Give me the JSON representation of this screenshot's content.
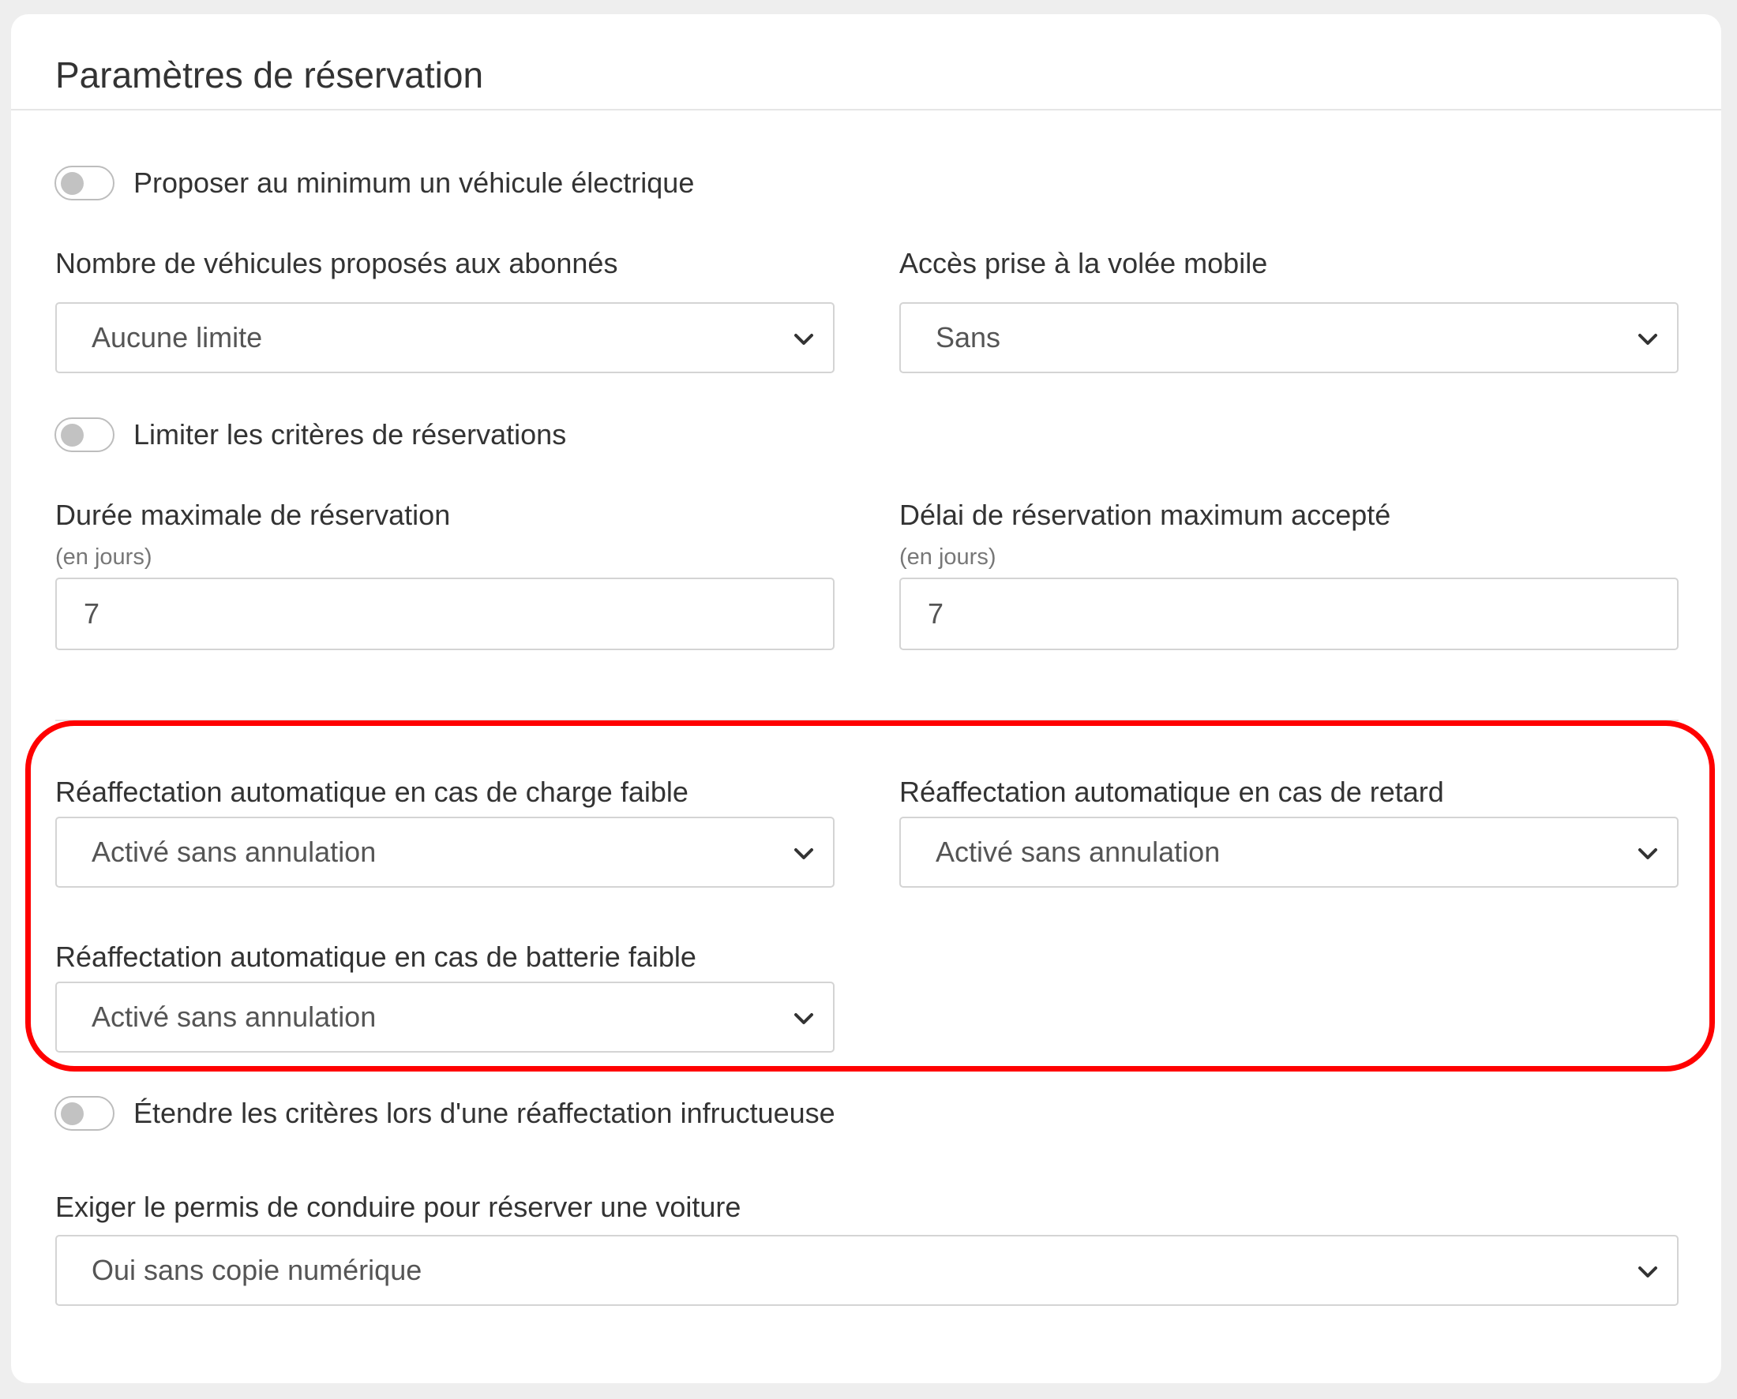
{
  "card": {
    "title": "Paramètres de réservation"
  },
  "toggles": {
    "electric": {
      "label": "Proposer au minimum un véhicule électrique",
      "on": false
    },
    "limit_criteria": {
      "label": "Limiter les critères de réservations",
      "on": false
    },
    "extend_criteria": {
      "label": "Étendre les critères lors d'une réaffectation infructueuse",
      "on": false
    }
  },
  "fields": {
    "vehicle_count": {
      "label": "Nombre de véhicules proposés aux abonnés",
      "value": "Aucune limite"
    },
    "mobile_access": {
      "label": "Accès prise à la volée mobile",
      "value": "Sans"
    },
    "max_duration": {
      "label": "Durée maximale de réservation",
      "unit": "(en jours)",
      "value": "7"
    },
    "max_delay": {
      "label": "Délai de réservation maximum accepté",
      "unit": "(en jours)",
      "value": "7"
    },
    "realloc_low_charge": {
      "label": "Réaffectation automatique en cas de charge faible",
      "value": "Activé sans annulation"
    },
    "realloc_delay": {
      "label": "Réaffectation automatique en cas de retard",
      "value": "Activé sans annulation"
    },
    "realloc_low_battery": {
      "label": "Réaffectation automatique en cas de batterie faible",
      "value": "Activé sans annulation"
    },
    "license": {
      "label": "Exiger le permis de conduire pour réserver une voiture",
      "value": "Oui sans copie numérique"
    }
  },
  "icons": {
    "select_arrow": "chevron-down-icon"
  },
  "colors": {
    "highlight": "#ff0000",
    "toggle_off": "#c2c2c2",
    "card_bg": "#ffffff",
    "page_bg": "#eeeeee"
  }
}
